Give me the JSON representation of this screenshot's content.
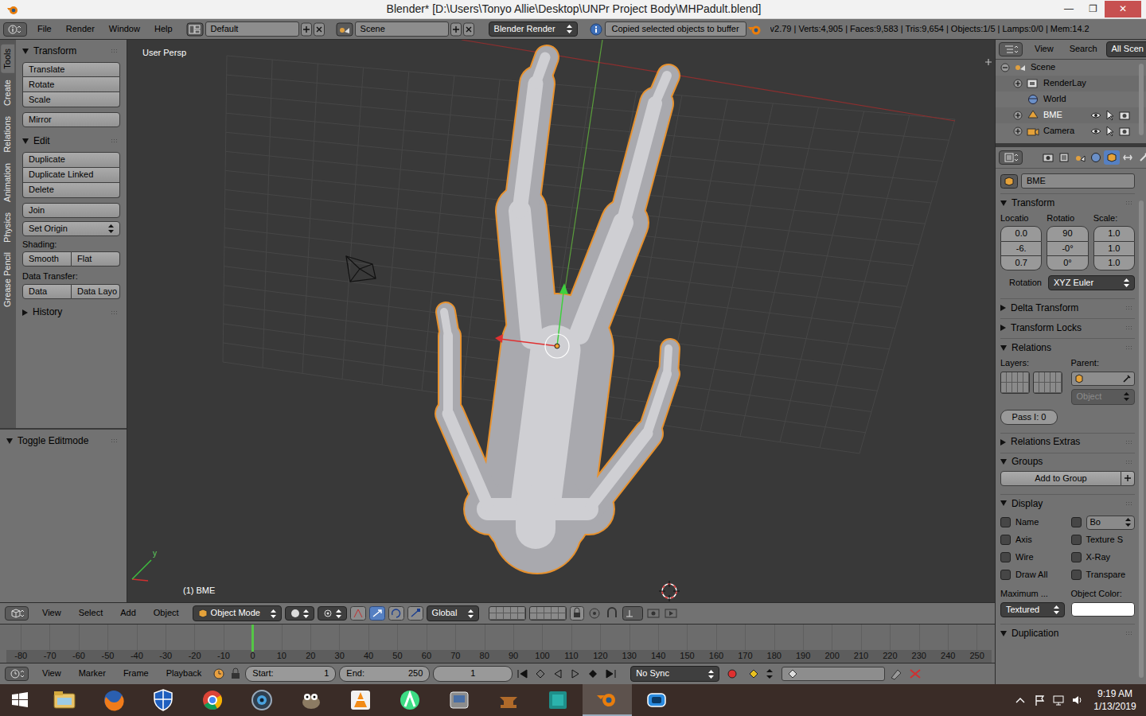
{
  "window": {
    "title": "Blender* [D:\\Users\\Tonyo Allie\\Desktop\\UNPr Project Body\\MHPadult.blend]",
    "controls": [
      "—",
      "❐",
      "✕"
    ]
  },
  "info_header": {
    "menus": [
      "File",
      "Render",
      "Window",
      "Help"
    ],
    "layout": "Default",
    "scene": "Scene",
    "engine": "Blender Render",
    "report": "Copied selected objects to buffer",
    "stats": "v2.79 | Verts:4,905 | Faces:9,583 | Tris:9,654 | Objects:1/5 | Lamps:0/0 | Mem:14.2"
  },
  "tool_tabs": [
    {
      "label": "Tools",
      "selected": true
    },
    {
      "label": "Create",
      "selected": false
    },
    {
      "label": "Relations",
      "selected": false
    },
    {
      "label": "Animation",
      "selected": false
    },
    {
      "label": "Physics",
      "selected": false
    },
    {
      "label": "Grease Pencil",
      "selected": false
    }
  ],
  "tool_panel": {
    "transform": {
      "title": "Transform",
      "expanded": true,
      "groups": [
        [
          "Translate",
          "Rotate",
          "Scale"
        ],
        [
          "Mirror"
        ]
      ]
    },
    "edit": {
      "title": "Edit",
      "expanded": true,
      "groups": [
        [
          "Duplicate",
          "Duplicate Linked",
          "Delete"
        ],
        [
          "Join"
        ]
      ],
      "set_origin": "Set Origin",
      "shading_label": "Shading:",
      "shading": [
        "Smooth",
        "Flat"
      ],
      "data_transfer_label": "Data Transfer:",
      "data_transfer": [
        "Data",
        "Data Layo"
      ]
    },
    "history": {
      "title": "History",
      "expanded": false
    },
    "operator": {
      "title": "Toggle Editmode",
      "expanded": true
    }
  },
  "viewport": {
    "view_name": "User Persp",
    "object_label": "(1) BME",
    "axis_label": "y"
  },
  "viewport_header": {
    "menus": [
      "View",
      "Select",
      "Add",
      "Object"
    ],
    "mode": "Object Mode",
    "orientation": "Global"
  },
  "timeline": {
    "ticks": [
      {
        "label": "-80",
        "current": false
      },
      {
        "label": "-70",
        "current": false
      },
      {
        "label": "-60",
        "current": false
      },
      {
        "label": "-50",
        "current": false
      },
      {
        "label": "-40",
        "current": false
      },
      {
        "label": "-30",
        "current": false
      },
      {
        "label": "-20",
        "current": false
      },
      {
        "label": "-10",
        "current": false
      },
      {
        "label": "0",
        "current": true
      },
      {
        "label": "10",
        "current": false
      },
      {
        "label": "20",
        "current": false
      },
      {
        "label": "30",
        "current": false
      },
      {
        "label": "40",
        "current": false
      },
      {
        "label": "50",
        "current": false
      },
      {
        "label": "60",
        "current": false
      },
      {
        "label": "70",
        "current": false
      },
      {
        "label": "80",
        "current": false
      },
      {
        "label": "90",
        "current": false
      },
      {
        "label": "100",
        "current": false
      },
      {
        "label": "110",
        "current": false
      },
      {
        "label": "120",
        "current": false
      },
      {
        "label": "130",
        "current": false
      },
      {
        "label": "140",
        "current": false
      },
      {
        "label": "150",
        "current": false
      },
      {
        "label": "160",
        "current": false
      },
      {
        "label": "170",
        "current": false
      },
      {
        "label": "180",
        "current": false
      },
      {
        "label": "190",
        "current": false
      },
      {
        "label": "200",
        "current": false
      },
      {
        "label": "210",
        "current": false
      },
      {
        "label": "220",
        "current": false
      },
      {
        "label": "230",
        "current": false
      },
      {
        "label": "240",
        "current": false
      },
      {
        "label": "250",
        "current": false
      }
    ],
    "menus": [
      "View",
      "Marker",
      "Frame",
      "Playback"
    ],
    "start_label": "Start:",
    "start": "1",
    "end_label": "End:",
    "end": "250",
    "frame": "1",
    "sync": "No Sync"
  },
  "outliner": {
    "menus": [
      "View",
      "Search"
    ],
    "filter": "All Scen",
    "items": [
      {
        "label": "Scene",
        "kind": "scene",
        "expander": "open",
        "toggles": false,
        "selected": false
      },
      {
        "label": "RenderLay",
        "kind": "render-layers",
        "expander": "closed",
        "toggles": false,
        "selected": false
      },
      {
        "label": "World",
        "kind": "world",
        "expander": "none",
        "toggles": false,
        "selected": false
      },
      {
        "label": "BME",
        "kind": "mesh",
        "expander": "closed",
        "toggles": true,
        "selected": true
      },
      {
        "label": "Camera",
        "kind": "camera",
        "expander": "closed",
        "toggles": true,
        "selected": false
      }
    ]
  },
  "properties": {
    "contexts": [
      {
        "kind": "render",
        "selected": false
      },
      {
        "kind": "layers",
        "selected": false
      },
      {
        "kind": "scene",
        "selected": false
      },
      {
        "kind": "world",
        "selected": false
      },
      {
        "kind": "object",
        "selected": true
      },
      {
        "kind": "constraints",
        "selected": false
      },
      {
        "kind": "modifiers",
        "selected": false
      }
    ],
    "object_name": "BME",
    "panels": [
      {
        "kind": "transform",
        "title": "Transform",
        "expanded": true,
        "columns": [
          {
            "label": "Locatio",
            "values": [
              "0.0",
              "-6.",
              "0.7"
            ]
          },
          {
            "label": "Rotatio",
            "values": [
              "90",
              "-0°",
              "0°"
            ]
          },
          {
            "label": "Scale:",
            "values": [
              "1.0",
              "1.0",
              "1.0"
            ]
          }
        ],
        "rotation_label": "Rotation",
        "rotation_mode": "XYZ Euler"
      },
      {
        "kind": "plain",
        "title": "Delta Transform",
        "expanded": false
      },
      {
        "kind": "plain",
        "title": "Transform Locks",
        "expanded": false
      },
      {
        "kind": "relations",
        "title": "Relations",
        "expanded": true,
        "layers_label": "Layers:",
        "parent_label": "Parent:",
        "parent_type": "Object",
        "parent_type_disabled": true,
        "pass_index": "Pass I: 0"
      },
      {
        "kind": "plain",
        "title": "Relations Extras",
        "expanded": false
      },
      {
        "kind": "groups",
        "title": "Groups",
        "expanded": true,
        "button": "Add to Group"
      },
      {
        "kind": "display",
        "title": "Display",
        "expanded": true,
        "left_checks": [
          {
            "label": "Name",
            "checked": false
          },
          {
            "label": "Axis",
            "checked": false
          },
          {
            "label": "Wire",
            "checked": false
          },
          {
            "label": "Draw All",
            "checked": false
          }
        ],
        "bounds_checked": false,
        "bounds_type": "Bo",
        "right_checks": [
          {
            "label": "Texture S",
            "checked": false
          },
          {
            "label": "X-Ray",
            "checked": false
          },
          {
            "label": "Transpare",
            "checked": false
          }
        ],
        "max_label": "Maximum ...",
        "max_value": "Textured",
        "color_label": "Object Color:",
        "object_color": "#ffffff"
      },
      {
        "kind": "plain",
        "title": "Duplication",
        "expanded": true
      }
    ]
  },
  "taskbar": {
    "apps": [
      {
        "kind": "explorer",
        "selected": false
      },
      {
        "kind": "firefox",
        "selected": false
      },
      {
        "kind": "defender",
        "selected": false
      },
      {
        "kind": "chrome",
        "selected": false
      },
      {
        "kind": "webcam",
        "selected": false
      },
      {
        "kind": "gimp",
        "selected": false
      },
      {
        "kind": "vlc",
        "selected": false
      },
      {
        "kind": "android-studio",
        "selected": false
      },
      {
        "kind": "emulator",
        "selected": false
      },
      {
        "kind": "anvil",
        "selected": false
      },
      {
        "kind": "3ds-max",
        "selected": false
      },
      {
        "kind": "blender",
        "selected": true
      },
      {
        "kind": "app",
        "selected": false
      }
    ],
    "tray": [
      {
        "kind": "show-hidden"
      },
      {
        "kind": "flag"
      },
      {
        "kind": "network"
      },
      {
        "kind": "volume"
      }
    ],
    "time": "9:19 AM",
    "date": "1/13/2019"
  }
}
